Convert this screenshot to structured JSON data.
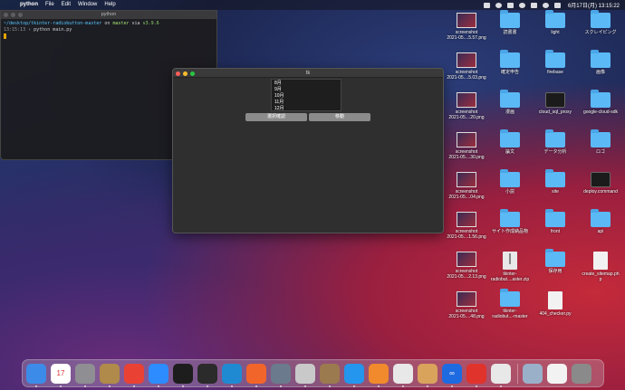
{
  "menubar": {
    "apple": "",
    "app_name": "python",
    "items": [
      "File",
      "Edit",
      "Window",
      "Help"
    ],
    "clock": "6月17日(月) 13:15:22"
  },
  "terminal": {
    "title": "python",
    "line1_path": "~/desktop/tkinter-radiobutton-master",
    "line1_on": "on",
    "line1_branch": "master",
    "line1_via": "via",
    "line1_ver": "v3.9.6",
    "line2_time": "13:15:13",
    "line2_cmd": "python main.py"
  },
  "tk_window": {
    "title": "tk",
    "list_items": [
      "8月",
      "9月",
      "10月",
      "11月",
      "12月"
    ],
    "button_confirm": "選択確認",
    "button_move": "移動"
  },
  "desktop_icons": [
    {
      "label": "screenshot",
      "sub": "2021-05....5.57.png",
      "kind": "shot"
    },
    {
      "label": "読書書",
      "sub": "",
      "kind": "folder"
    },
    {
      "label": "light",
      "sub": "",
      "kind": "folder"
    },
    {
      "label": "スクレイピング",
      "sub": "",
      "kind": "folder"
    },
    {
      "label": "screenshot",
      "sub": "2021-05....5.03.png",
      "kind": "shot"
    },
    {
      "label": "確定申告",
      "sub": "",
      "kind": "folder"
    },
    {
      "label": "firebase",
      "sub": "",
      "kind": "folder"
    },
    {
      "label": "画像",
      "sub": "",
      "kind": "folder"
    },
    {
      "label": "screenshot",
      "sub": "2021-05....20.png",
      "kind": "shot"
    },
    {
      "label": "漫画",
      "sub": "",
      "kind": "folder"
    },
    {
      "label": "cloud_sql_proxy",
      "sub": "",
      "kind": "exec"
    },
    {
      "label": "google-cloud-sdk",
      "sub": "",
      "kind": "folder"
    },
    {
      "label": "screenshot",
      "sub": "2021-05....30.png",
      "kind": "shot"
    },
    {
      "label": "論文",
      "sub": "",
      "kind": "folder"
    },
    {
      "label": "データ分析",
      "sub": "",
      "kind": "folder"
    },
    {
      "label": "ロゴ",
      "sub": "",
      "kind": "folder"
    },
    {
      "label": "screenshot",
      "sub": "2021-05....04.png",
      "kind": "shot"
    },
    {
      "label": "小説",
      "sub": "",
      "kind": "folder"
    },
    {
      "label": "site",
      "sub": "",
      "kind": "folder"
    },
    {
      "label": "deploy.command",
      "sub": "",
      "kind": "exec"
    },
    {
      "label": "screenshot",
      "sub": "2021-05....1.56.png",
      "kind": "shot"
    },
    {
      "label": "サイト作成納品物",
      "sub": "",
      "kind": "folder"
    },
    {
      "label": "front",
      "sub": "",
      "kind": "folder"
    },
    {
      "label": "api",
      "sub": "",
      "kind": "folder"
    },
    {
      "label": "screenshot",
      "sub": "2021-05....2.13.png",
      "kind": "shot"
    },
    {
      "label": "tkinter-",
      "sub": "radiobut....aster.zip",
      "kind": "zip"
    },
    {
      "label": "保存用",
      "sub": "",
      "kind": "folder"
    },
    {
      "label": "create_sitemap.ph",
      "sub": "p",
      "kind": "doc"
    },
    {
      "label": "screenshot",
      "sub": "2021-05....48.png",
      "kind": "shot"
    },
    {
      "label": "tkinter-",
      "sub": "radiobut...-master",
      "kind": "folder"
    },
    {
      "label": "404_checker.py",
      "sub": "",
      "kind": "doc"
    }
  ],
  "dock": {
    "apps": [
      {
        "name": "finder-icon",
        "color": "#3d8be8",
        "glyph": ""
      },
      {
        "name": "calendar-icon",
        "color": "#ffffff",
        "glyph": "17"
      },
      {
        "name": "system-preferences-icon",
        "color": "#8e8e93",
        "glyph": ""
      },
      {
        "name": "notes-icon",
        "color": "#b08a4a",
        "glyph": ""
      },
      {
        "name": "chrome-icon",
        "color": "#e94235",
        "glyph": ""
      },
      {
        "name": "zoom-icon",
        "color": "#2d8cff",
        "glyph": ""
      },
      {
        "name": "terminal-icon",
        "color": "#1d1d1d",
        "glyph": ""
      },
      {
        "name": "terminal-2-icon",
        "color": "#2b2b2b",
        "glyph": ""
      },
      {
        "name": "vscode-icon",
        "color": "#1f8ad2",
        "glyph": ""
      },
      {
        "name": "safari-icon",
        "color": "#f2652a",
        "glyph": ""
      },
      {
        "name": "quicktime-icon",
        "color": "#6b7a8c",
        "glyph": ""
      },
      {
        "name": "sequel-icon",
        "color": "#c9c9c9",
        "glyph": ""
      },
      {
        "name": "archive-icon",
        "color": "#9b7a4f",
        "glyph": ""
      },
      {
        "name": "docker-icon",
        "color": "#2496ed",
        "glyph": ""
      },
      {
        "name": "sourcetree-icon",
        "color": "#f08a2c",
        "glyph": ""
      },
      {
        "name": "postgres-icon",
        "color": "#e8e8e8",
        "glyph": ""
      },
      {
        "name": "preview-icon",
        "color": "#d9a35c",
        "glyph": ""
      },
      {
        "name": "infinity-icon",
        "color": "#1e6ae0",
        "glyph": "∞"
      },
      {
        "name": "clock-icon",
        "color": "#e0332c",
        "glyph": ""
      },
      {
        "name": "books-icon",
        "color": "#e8e8e8",
        "glyph": ""
      }
    ],
    "right": [
      {
        "name": "downloads-stack-icon",
        "color": "#9ab0c8"
      },
      {
        "name": "document-stack-icon",
        "color": "#f2f2f2"
      },
      {
        "name": "trash-icon",
        "color": "#8a8a8a"
      }
    ]
  }
}
